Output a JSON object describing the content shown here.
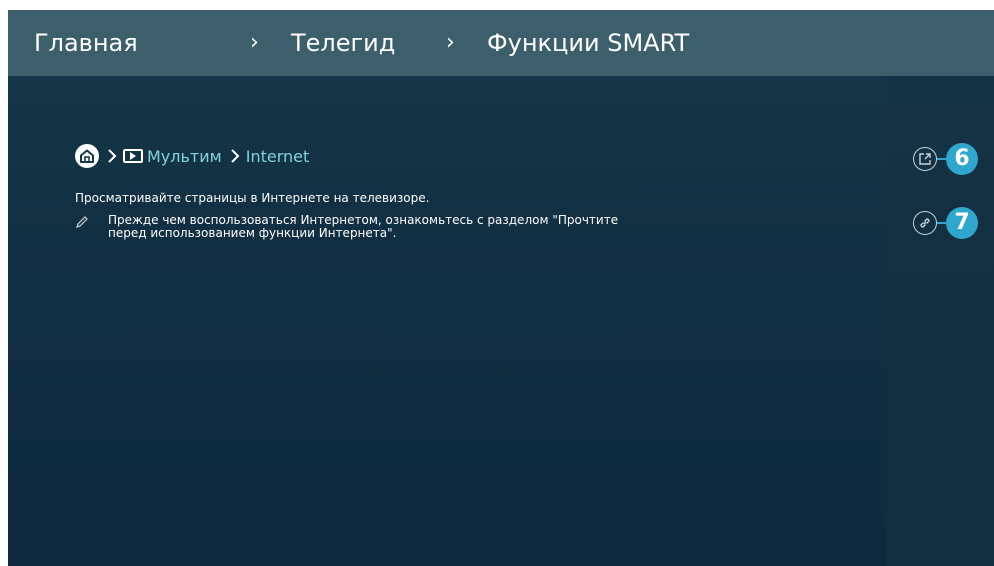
{
  "header": {
    "crumbs": [
      "Главная",
      "Телегид",
      "Функции SMART"
    ],
    "separator": "›"
  },
  "path": {
    "home_icon": "home-icon",
    "items": [
      {
        "icon": "tv-play-icon",
        "label": "Мультим"
      },
      {
        "label": "Internet"
      }
    ]
  },
  "content": {
    "description": "Просматривайте страницы в Интернете на телевизоре.",
    "note_line1": "Прежде чем воспользоваться Интернетом, ознакомьтесь с разделом \"Прочтите",
    "note_line2": "перед использованием функции Интернета\"."
  },
  "side_buttons": [
    {
      "icon": "external-link-icon",
      "number": "6"
    },
    {
      "icon": "link-icon",
      "number": "7"
    }
  ],
  "colors": {
    "header_bg": "#3d5f6b",
    "background": "#112f42",
    "link": "#7fd3e0",
    "badge": "#2fa6cc"
  }
}
